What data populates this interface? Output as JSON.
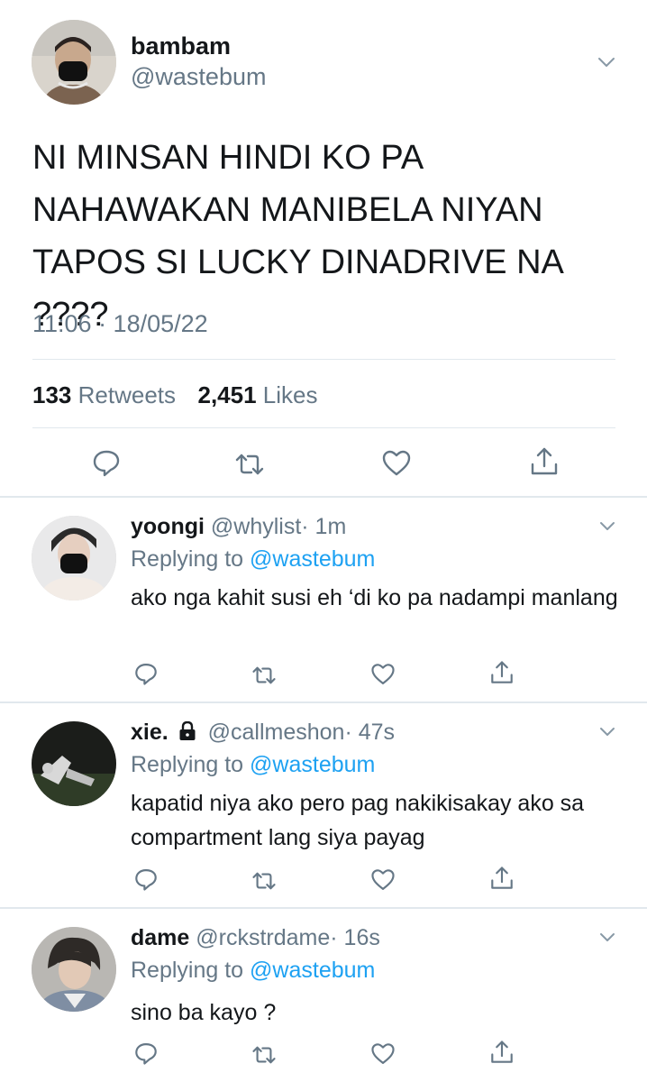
{
  "main_tweet": {
    "name": "bambam",
    "handle": "@wastebum",
    "text": "NI MINSAN HINDI KO PA NAHAWAKAN MANIBELA NIYAN TAPOS SI LUCKY DINADRIVE NA ????",
    "timestamp": "11:06 · 18/05/22",
    "retweets_count": "133",
    "retweets_label": "Retweets",
    "likes_count": "2,451",
    "likes_label": "Likes"
  },
  "replies": [
    {
      "name": "yoongi",
      "handle": "@whylist",
      "time": "· 1m",
      "replying_prefix": "Replying to",
      "replying_to": "@wastebum",
      "text": "ako nga kahit susi eh ‘di ko pa nadampi manlang"
    },
    {
      "name": "xie.",
      "handle": "@callmeshon",
      "time": "· 47s",
      "replying_prefix": "Replying to",
      "replying_to": "@wastebum",
      "text": "kapatid niya ako pero pag nakikisakay ako sa compartment lang siya payag"
    },
    {
      "name": "dame",
      "handle": "@rckstrdame",
      "time": "· 16s",
      "replying_prefix": "Replying to",
      "replying_to": "@wastebum",
      "text": "sino ba kayo ?"
    }
  ],
  "icons": {
    "reply": "reply-icon",
    "retweet": "retweet-icon",
    "like": "heart-icon",
    "share": "share-icon",
    "menu": "chevron-down-icon",
    "lock": "lock-icon"
  },
  "colors": {
    "text_primary": "#14171a",
    "text_secondary": "#657786",
    "link": "#1da1f2",
    "divider": "#e1e8ed"
  }
}
